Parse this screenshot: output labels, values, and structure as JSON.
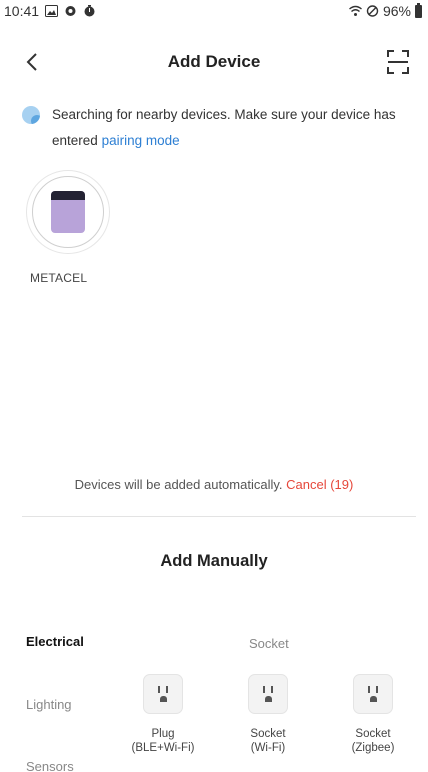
{
  "status_bar": {
    "time": "10:41",
    "battery": "96%"
  },
  "header": {
    "title": "Add Device"
  },
  "search": {
    "message": "Searching for nearby devices. Make sure your device has entered",
    "link": "pairing mode"
  },
  "found_devices": [
    {
      "name": "METACEL"
    }
  ],
  "auto_add": {
    "text": "Devices will be added automatically.",
    "cancel": "Cancel (19)"
  },
  "manual": {
    "title": "Add Manually",
    "categories": [
      {
        "label": "Electrical",
        "active": true
      },
      {
        "label": "Lighting",
        "active": false
      },
      {
        "label": "Sensors",
        "active": false
      }
    ],
    "section": "Socket",
    "products": [
      {
        "line1": "Plug",
        "line2": "(BLE+Wi-Fi)"
      },
      {
        "line1": "Socket",
        "line2": "(Wi-Fi)"
      },
      {
        "line1": "Socket",
        "line2": "(Zigbee)"
      }
    ]
  }
}
